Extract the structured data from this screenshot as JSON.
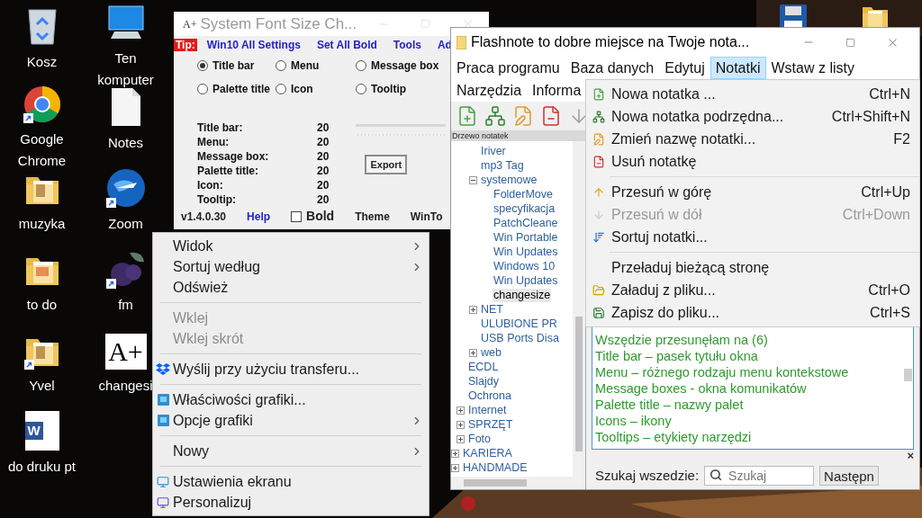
{
  "desktop_icons": [
    {
      "label": "Kosz",
      "kind": "recycle",
      "shortcut": false
    },
    {
      "label": "Google Chrome",
      "kind": "browser",
      "shortcut": true
    },
    {
      "label": "muzyka",
      "kind": "folder",
      "shortcut": false
    },
    {
      "label": "to do",
      "kind": "folder-pdf",
      "shortcut": false
    },
    {
      "label": "Yvel",
      "kind": "folder",
      "shortcut": true
    },
    {
      "label": "do druku pt",
      "kind": "word",
      "icon_text": "W",
      "shortcut": false
    },
    {
      "label": "Ten komputer",
      "kind": "computer",
      "shortcut": false
    },
    {
      "label": "Notes",
      "kind": "document",
      "shortcut": false
    },
    {
      "label": "Zoom",
      "kind": "globe",
      "shortcut": true
    },
    {
      "label": "fm",
      "kind": "fruit",
      "shortcut": true
    },
    {
      "label": "changesi",
      "kind": "letters",
      "icon_text": "A+",
      "shortcut": false
    }
  ],
  "top_right_icons": [
    {
      "kind": "floppy"
    },
    {
      "kind": "folder"
    }
  ],
  "font_window": {
    "icon_text": "A+",
    "title": "System Font Size Ch...",
    "tip": "Tip:",
    "links": [
      "Win10 All Settings",
      "Set All Bold",
      "Tools",
      "Ad"
    ],
    "radios": [
      {
        "label": "Title bar",
        "selected": true
      },
      {
        "label": "Menu",
        "selected": false
      },
      {
        "label": "Message box",
        "selected": false
      },
      {
        "label": "Palette title",
        "selected": false
      },
      {
        "label": "Icon",
        "selected": false
      },
      {
        "label": "Tooltip",
        "selected": false
      }
    ],
    "sizes": [
      {
        "label": "Title bar:",
        "value": "20"
      },
      {
        "label": "Menu:",
        "value": "20"
      },
      {
        "label": "Message box:",
        "value": "20"
      },
      {
        "label": "Palette title:",
        "value": "20"
      },
      {
        "label": "Icon:",
        "value": "20"
      },
      {
        "label": "Tooltip:",
        "value": "20"
      }
    ],
    "export_button": "Export",
    "footer": {
      "version": "v1.4.0.30",
      "help": "Help",
      "bold": {
        "label": "Bold",
        "checked": false
      },
      "theme": "Theme",
      "wintools": "WinTo"
    }
  },
  "flashnote": {
    "title": "Flashnote to dobre miejsce na Twoje nota...",
    "menu": [
      {
        "label": "Praca programu",
        "selected": false
      },
      {
        "label": "Baza danych",
        "selected": false
      },
      {
        "label": "Edytuj",
        "selected": false
      },
      {
        "label": "Notatki",
        "selected": true
      },
      {
        "label": "Wstaw z listy",
        "selected": false
      },
      {
        "label": "Narzędzia",
        "selected": false
      },
      {
        "label": "Informa",
        "selected": false
      }
    ],
    "toolbar": [
      {
        "kind": "new-note"
      },
      {
        "kind": "sub-note"
      },
      {
        "kind": "rename"
      },
      {
        "kind": "delete"
      },
      {
        "kind": "move-down"
      }
    ],
    "tree_header": "Drzewo notatek",
    "tree": [
      {
        "children": [
          {
            "children": [
              {
                "label": "Iriver",
                "selected": false
              },
              {
                "label": "mp3 Tag",
                "selected": false
              },
              {
                "label": "systemowe",
                "expanded": true,
                "selected": false,
                "children": [
                  {
                    "label": "FolderMove",
                    "selected": false
                  },
                  {
                    "label": "specyfikacja",
                    "selected": false
                  },
                  {
                    "label": "PatchCleane",
                    "selected": false
                  },
                  {
                    "label": "Win Portable",
                    "selected": false
                  },
                  {
                    "label": "Win Updates",
                    "selected": false
                  },
                  {
                    "label": "Windows 10",
                    "selected": false
                  },
                  {
                    "label": "Win Updates",
                    "selected": false
                  },
                  {
                    "label": "changesize",
                    "selected": true
                  }
                ]
              },
              {
                "label": "NET",
                "expanded": false,
                "selected": false
              },
              {
                "label": "ULUBIONE PR",
                "selected": false
              },
              {
                "label": "USB Ports Disa",
                "selected": false
              },
              {
                "label": "web",
                "expanded": false,
                "selected": false
              }
            ]
          },
          {
            "label": "ECDL",
            "selected": false
          },
          {
            "label": "Slajdy",
            "selected": false
          },
          {
            "label": "Ochrona",
            "selected": false
          },
          {
            "label": "Internet",
            "expanded": false,
            "selected": false
          },
          {
            "label": "SPRZĘT",
            "expanded": false,
            "selected": false
          },
          {
            "label": "Foto",
            "expanded": false,
            "selected": false
          }
        ]
      },
      {
        "label": "KARIERA",
        "expanded": false,
        "selected": false
      },
      {
        "label": "HANDMADE",
        "expanded": false,
        "selected": false
      }
    ],
    "note_lines": [
      "Wszędzie przesunęłam na (6)",
      "Title bar – pasek tytułu okna",
      "Menu – różnego rodzaju menu kontekstowe",
      "Message boxes - okna komunikatów",
      "Palette title – nazwy palet",
      "Icons – ikony",
      "Tooltips – etykiety narzędzi"
    ],
    "close_panel": "×",
    "search": {
      "label": "Szukaj wszedzie:",
      "placeholder": "Szukaj",
      "next_button": "Następn"
    }
  },
  "notes_menu": [
    {
      "kind": "new-note",
      "label": "Nowa notatka ...",
      "shortcut": "Ctrl+N",
      "disabled": false
    },
    {
      "kind": "sub-note",
      "label": "Nowa notatka podrzędna...",
      "shortcut": "Ctrl+Shift+N",
      "disabled": false
    },
    {
      "kind": "rename",
      "label": "Zmień nazwę notatki...",
      "shortcut": "F2",
      "disabled": false
    },
    {
      "kind": "delete",
      "label": "Usuń notatkę",
      "disabled": false
    },
    {
      "kind": "separator"
    },
    {
      "kind": "move-up",
      "label": "Przesuń w górę",
      "shortcut": "Ctrl+Up",
      "disabled": false
    },
    {
      "kind": "move-down",
      "label": "Przesuń w dół",
      "shortcut": "Ctrl+Down",
      "disabled": true
    },
    {
      "kind": "sort",
      "label": "Sortuj notatki...",
      "disabled": false
    },
    {
      "kind": "separator"
    },
    {
      "kind": "plain",
      "label": "Przeładuj bieżącą stronę",
      "disabled": false
    },
    {
      "kind": "open",
      "label": "Załaduj z pliku...",
      "shortcut": "Ctrl+O",
      "disabled": false
    },
    {
      "kind": "save",
      "label": "Zapisz do pliku...",
      "shortcut": "Ctrl+S",
      "disabled": false
    }
  ],
  "context_menu": [
    {
      "kind": "item",
      "label": "Widok",
      "submenu": true,
      "disabled": false
    },
    {
      "kind": "item",
      "label": "Sortuj według",
      "submenu": true,
      "disabled": false
    },
    {
      "kind": "item",
      "label": "Odśwież",
      "submenu": false,
      "disabled": false
    },
    {
      "kind": "separator"
    },
    {
      "kind": "item",
      "label": "Wklej",
      "submenu": false,
      "disabled": true
    },
    {
      "kind": "item",
      "label": "Wklej skrót",
      "submenu": false,
      "disabled": true
    },
    {
      "kind": "separator"
    },
    {
      "kind": "dropbox",
      "label": "Wyślij przy użyciu transferu...",
      "submenu": false,
      "disabled": false
    },
    {
      "kind": "separator"
    },
    {
      "kind": "graphics",
      "label": "Właściwości grafiki...",
      "submenu": false,
      "disabled": false
    },
    {
      "kind": "graphics",
      "label": "Opcje grafiki",
      "submenu": true,
      "disabled": false
    },
    {
      "kind": "separator"
    },
    {
      "kind": "item",
      "label": "Nowy",
      "submenu": true,
      "disabled": false
    },
    {
      "kind": "separator"
    },
    {
      "kind": "display",
      "label": "Ustawienia ekranu",
      "submenu": false,
      "disabled": false
    },
    {
      "kind": "personalize",
      "label": "Personalizuj",
      "submenu": false,
      "disabled": false
    }
  ]
}
